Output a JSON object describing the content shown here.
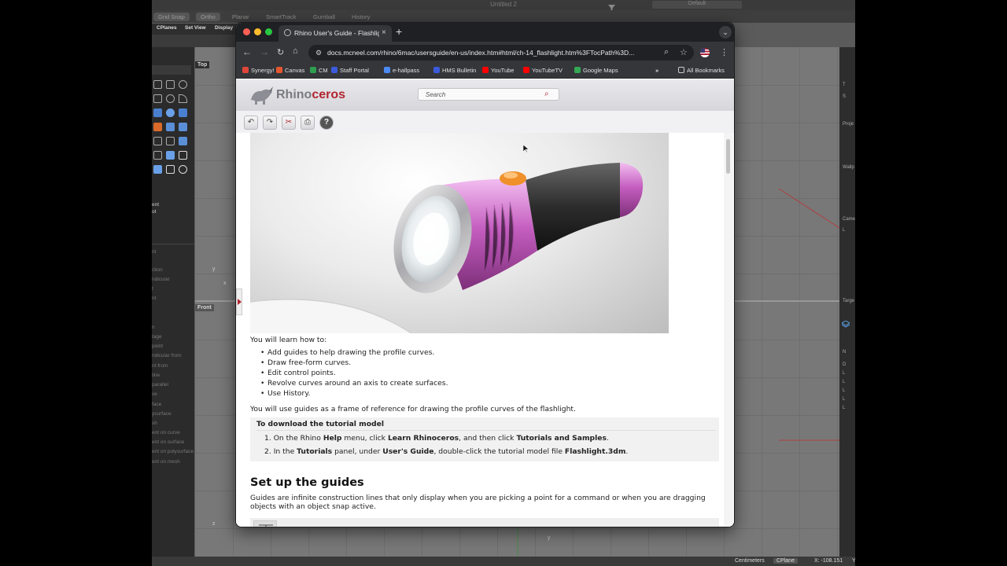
{
  "rhino": {
    "doc_title": "Untitled 2",
    "modes": [
      "Grid Snap",
      "Ortho",
      "Planar",
      "SmartTrack",
      "Gumball",
      "History"
    ],
    "layer_field": "Default",
    "tabs": [
      "CPlanes",
      "Set View",
      "Display"
    ],
    "viewports": {
      "top_label": "Top",
      "front_label": "Front"
    },
    "osnaps": [
      "ent",
      "ot",
      "nt",
      "ction",
      "ndicular",
      "t",
      "nt",
      "n",
      "tage",
      "point",
      "ndicular from",
      "nt from",
      "line",
      "parallel",
      "ve",
      "face",
      "ysurface",
      "sh",
      "ent on curve",
      "ent on surface",
      "ent on polysurface",
      "ent on mesh"
    ],
    "right_panel": [
      "T",
      "S",
      "Proje",
      "Wallp",
      "Came",
      "L",
      "Targe",
      "N",
      "D",
      "L",
      "L",
      "L",
      "L",
      "L"
    ],
    "status": {
      "units": "Centimeters",
      "cplane": "CPlane",
      "coords": "X: -108.151",
      "y": "Y"
    }
  },
  "browser": {
    "tab_title": "Rhino User's Guide - Flashlight",
    "url": "docs.mcneel.com/rhino/6mac/usersguide/en-us/index.htm#html/ch-14_flashlight.htm%3FTocPath%3D...",
    "bookmarks": [
      {
        "label": "Synergy!",
        "color": "#e0453a"
      },
      {
        "label": "Canvas",
        "color": "#e4572e"
      },
      {
        "label": "CM",
        "color": "#2e9e4f"
      },
      {
        "label": "Staff Portal",
        "color": "#3b5bdb"
      },
      {
        "label": "e-hallpass",
        "color": "#4c8bf5"
      },
      {
        "label": "HMS Bulletin",
        "color": "#3b5bdb"
      },
      {
        "label": "YouTube",
        "color": "#ff0000"
      },
      {
        "label": "YouTubeTV",
        "color": "#ff0000"
      },
      {
        "label": "Google Maps",
        "color": "#34a853"
      }
    ],
    "all_bookmarks": "All Bookmarks"
  },
  "site": {
    "logo_prefix": "Rhino",
    "logo_suffix": "ceros",
    "search_placeholder": "Search"
  },
  "article": {
    "intro": "You will learn how to:",
    "bullets": [
      "Add guides to help drawing the profile curves.",
      "Draw free-form curves.",
      "Edit control points.",
      "Revolve curves around an axis to create surfaces.",
      "Use History."
    ],
    "guides_note": "You will use guides as a frame of reference for drawing the profile curves of the flashlight.",
    "download_title": "To download the tutorial model",
    "steps": [
      {
        "n": "1.",
        "a": "On the Rhino ",
        "b": "Help",
        "c": " menu, click ",
        "d": "Learn Rhinoceros",
        "e": ", and then click ",
        "f": "Tutorials and Samples",
        "g": "."
      },
      {
        "n": "2.",
        "a": "In the ",
        "b": "Tutorials",
        "c": " panel, under ",
        "d": "User's Guide",
        "e": ", double-click the tutorial model file ",
        "f": "Flashlight.3dm",
        "g": "."
      }
    ],
    "section_heading": "Set up the guides",
    "section_text": "Guides are infinite construction lines that only display when you are picking a point for a command or when you are dragging objects with an object snap active."
  }
}
